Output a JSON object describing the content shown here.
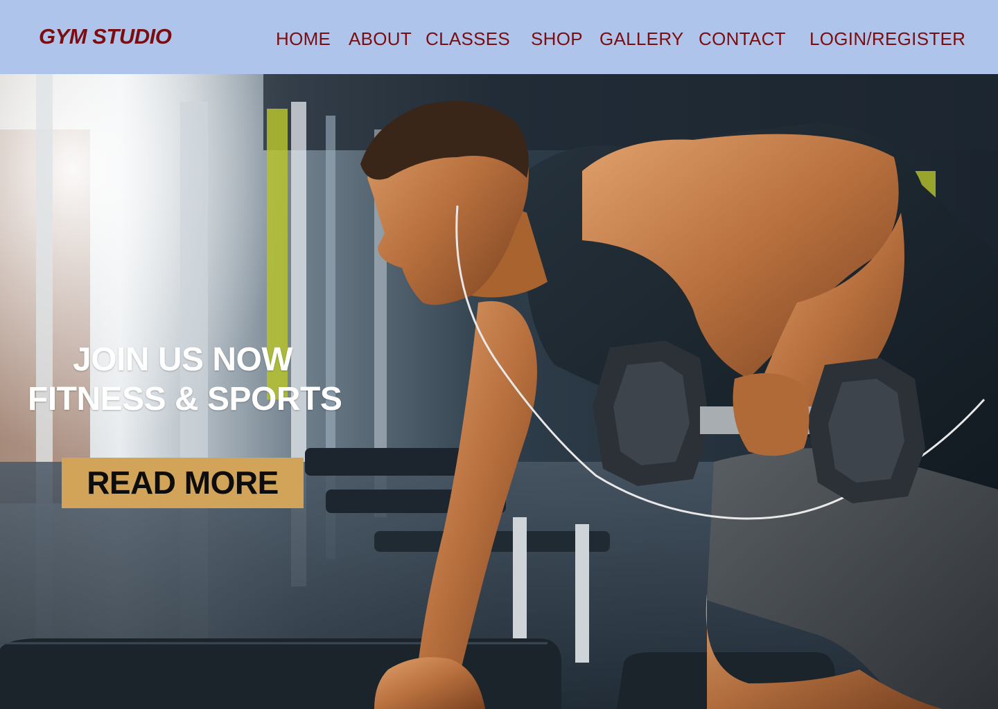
{
  "brand": {
    "name": "GYM STUDIO"
  },
  "nav": {
    "items": [
      {
        "label": "HOME"
      },
      {
        "label": "ABOUT"
      },
      {
        "label": "CLASSES"
      },
      {
        "label": "SHOP"
      },
      {
        "label": "GALLERY"
      },
      {
        "label": "CONTACT"
      },
      {
        "label": "LOGIN/REGISTER"
      }
    ]
  },
  "hero": {
    "heading_line1": "JOIN US NOW",
    "heading_line2": "FITNESS & SPORTS",
    "cta_label": "READ MORE"
  },
  "colors": {
    "navbar_bg": "#aec4ea",
    "brand_text": "#7b0d10",
    "nav_text": "#7b0d10",
    "hero_text": "#ffffff",
    "cta_bg": "#d2a459",
    "cta_text": "#0d0d0d"
  }
}
